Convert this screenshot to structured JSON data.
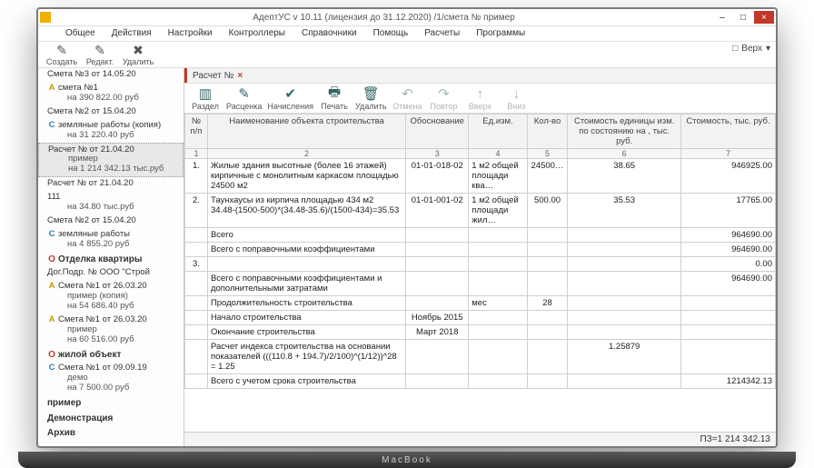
{
  "window": {
    "title": "АдептУС v 10.11 (лицензия до 31.12.2020) /1/смета № пример",
    "sys": {
      "min": "–",
      "max": "□",
      "close": "×"
    }
  },
  "menu": [
    "Общее",
    "Действия",
    "Настройки",
    "Контроллеры",
    "Справочники",
    "Помощь",
    "Расчеты",
    "Программы"
  ],
  "shelf": {
    "calendar": "□",
    "label": "Верх"
  },
  "leftTools": [
    {
      "icon": "✎",
      "label": "Создать"
    },
    {
      "icon": "✎",
      "label": "Редакт."
    },
    {
      "icon": "✖",
      "label": "Удалить"
    }
  ],
  "tree": [
    {
      "kind": "node",
      "badge": "",
      "text": "Смета №3 от 14.05.20"
    },
    {
      "kind": "sub",
      "badge": "A",
      "text": "смета №1",
      "text2": "на 390 822.00 руб"
    },
    {
      "kind": "node",
      "badge": "",
      "text": "Смета №2 от 15.04.20"
    },
    {
      "kind": "sub",
      "badge": "C",
      "text": "земляные работы (копия)",
      "text2": "на 31 220.40 руб"
    },
    {
      "kind": "sel",
      "badge": "",
      "text": "Расчет № от 21.04.20",
      "text2": "пример",
      "text3": "на 1 214 342.13 тыс.руб"
    },
    {
      "kind": "node",
      "badge": "",
      "text": "Расчет № от 21.04.20"
    },
    {
      "kind": "sub",
      "badge": "",
      "text": "111",
      "text2": "на 34.80 тыс.руб"
    },
    {
      "kind": "node",
      "badge": "",
      "text": "Смета №2 от 15.04.20"
    },
    {
      "kind": "sub",
      "badge": "C",
      "text": "земляные работы",
      "text2": "на 4 855.20 руб"
    },
    {
      "kind": "bold",
      "badge": "O",
      "text": "Отделка квартиры"
    },
    {
      "kind": "sub",
      "badge": "",
      "text": "Дог.Подр. № ООО \"Строй"
    },
    {
      "kind": "sub",
      "badge": "A",
      "text": "Смета №1 от 26.03.20",
      "text2": "пример (копия)",
      "text3": "на 54 686.40 руб"
    },
    {
      "kind": "sub",
      "badge": "A",
      "text": "Смета №1 от 26.03.20",
      "text2": "пример",
      "text3": "на 60 516.00 руб"
    },
    {
      "kind": "bold",
      "badge": "O",
      "text": "жилой объект"
    },
    {
      "kind": "sub",
      "badge": "C",
      "text": "Смета №1 от 09.09.19",
      "text2": "демо",
      "text3": "на 7 500.00 руб"
    },
    {
      "kind": "bold",
      "badge": "",
      "text": "пример"
    },
    {
      "kind": "bold",
      "badge": "",
      "text": "Демонстрация"
    },
    {
      "kind": "bold",
      "badge": "",
      "text": "Архив"
    }
  ],
  "tab": {
    "label": "Расчет №",
    "close": "×"
  },
  "toolbar2": [
    {
      "g": "▥",
      "label": "Раздел",
      "dis": false
    },
    {
      "g": "✎",
      "label": "Расценка",
      "dis": false
    },
    {
      "g": "✔",
      "label": "Начисления",
      "dis": false
    },
    {
      "g": "🖶",
      "label": "Печать",
      "dis": false
    },
    {
      "g": "🗑",
      "label": "Удалить",
      "dis": false
    },
    {
      "g": "↶",
      "label": "Отмена",
      "dis": true
    },
    {
      "g": "↷",
      "label": "Повтор",
      "dis": true
    },
    {
      "g": "↑",
      "label": "Вверх",
      "dis": true
    },
    {
      "g": "↓",
      "label": "Вниз",
      "dis": true
    }
  ],
  "grid": {
    "headers": [
      "№ п/п",
      "Наименование объекта строительства",
      "Обоснование",
      "Ед.изм.",
      "Кол-во",
      "Стоимость единицы изм. по состоянию на , тыс. руб.",
      "Стоимость, тыс. руб."
    ],
    "numrow": [
      "1",
      "2",
      "3",
      "4",
      "5",
      "6",
      "7"
    ],
    "rows": [
      {
        "n": "1.",
        "name": "Жилые здания высотные (более 16 этажей) кирпичные с монолитным каркасом площадью 24500 м2",
        "osn": "01-01-018-02",
        "ed": "1 м2 общей площади ква…",
        "kol": "24500…",
        "price": "38.65",
        "cost": "946925.00"
      },
      {
        "n": "2.",
        "name": "Таунхаусы из кирпича площадью 434 м2\n34.48-(1500-500)*(34.48-35.6)/(1500-434)=35.53",
        "osn": "01-01-001-02",
        "ed": "1 м2 общей площади жил…",
        "kol": "500.00",
        "price": "35.53",
        "cost": "17765.00"
      },
      {
        "n": "",
        "name": "Всего",
        "osn": "",
        "ed": "",
        "kol": "",
        "price": "",
        "cost": "964690.00"
      },
      {
        "n": "",
        "name": "Всего с поправочными коэффициентами",
        "osn": "",
        "ed": "",
        "kol": "",
        "price": "",
        "cost": "964690.00"
      },
      {
        "n": "3.",
        "name": "",
        "osn": "",
        "ed": "",
        "kol": "",
        "price": "",
        "cost": "0.00"
      },
      {
        "n": "",
        "name": "Всего с поправочными коэффициентами и дополнительными затратами",
        "osn": "",
        "ed": "",
        "kol": "",
        "price": "",
        "cost": "964690.00"
      },
      {
        "n": "",
        "name": "Продолжительность строительства",
        "osn": "",
        "ed": "мес",
        "kol": "28",
        "price": "",
        "cost": ""
      },
      {
        "n": "",
        "name": "Начало строительства",
        "osn": "Ноябрь 2015",
        "ed": "",
        "kol": "",
        "price": "",
        "cost": ""
      },
      {
        "n": "",
        "name": "Окончание строительства",
        "osn": "Март 2018",
        "ed": "",
        "kol": "",
        "price": "",
        "cost": ""
      },
      {
        "n": "",
        "name": "Расчет индекса строительства на основании показателей   (((110.8 + 194.7)/2/100)^(1/12))^28 = 1.25",
        "osn": "",
        "ed": "",
        "kol": "",
        "price": "1.25879",
        "cost": ""
      },
      {
        "n": "",
        "name": "Всего с учетом срока строительства",
        "osn": "",
        "ed": "",
        "kol": "",
        "price": "",
        "cost": "1214342.13"
      }
    ]
  },
  "status": "ПЗ=1 214 342.13"
}
